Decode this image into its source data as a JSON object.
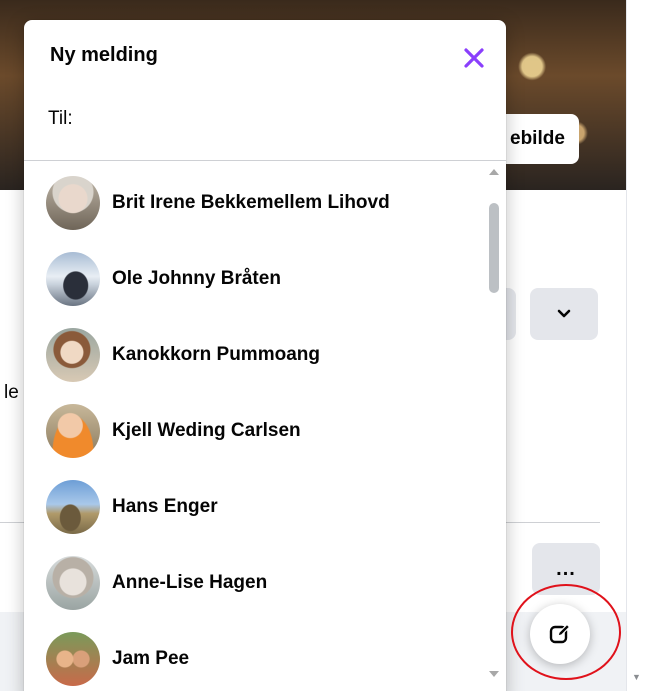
{
  "background": {
    "cover_button_label": "ebilde",
    "more_button_label": "...",
    "partial_text": "le"
  },
  "dialog": {
    "title": "Ny melding",
    "to_label": "Til:",
    "to_placeholder": "",
    "close_icon": "close-icon",
    "accent_color": "#8a3ffc"
  },
  "contacts": [
    {
      "name": "Brit Irene Bekkemellem Lihovd"
    },
    {
      "name": "Ole Johnny Bråten"
    },
    {
      "name": "Kanokkorn Pummoang"
    },
    {
      "name": "Kjell Weding Carlsen"
    },
    {
      "name": "Hans Enger"
    },
    {
      "name": "Anne-Lise Hagen"
    },
    {
      "name": "Jam Pee"
    }
  ],
  "fab": {
    "icon": "compose-icon",
    "highlight_color": "#e0121b"
  }
}
